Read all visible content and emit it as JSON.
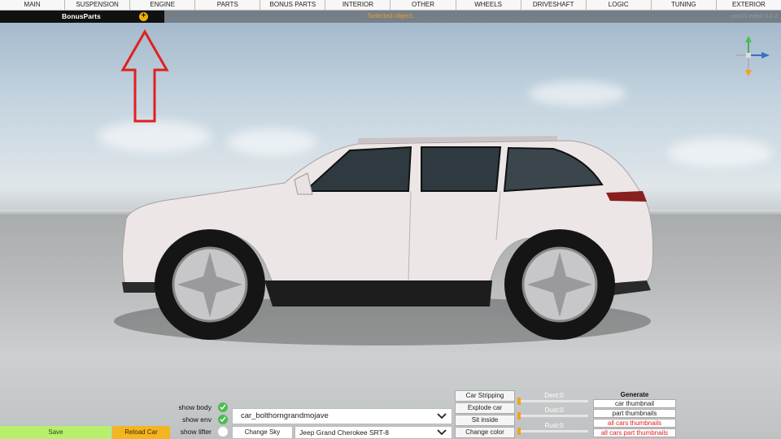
{
  "top_menu": {
    "tabs": [
      "MAIN",
      "SUSPENSION",
      "ENGINE",
      "PARTS",
      "BONUS PARTS",
      "INTERIOR",
      "OTHER",
      "WHEELS",
      "DRIVESHAFT",
      "LOGIC",
      "TUNING",
      "EXTERIOR"
    ]
  },
  "sub_bar": {
    "section_label": "BonusParts",
    "add_icon": "plus-circle-icon",
    "selected_object_label": "Selected object:",
    "version": "cms21 editor 1.0.2"
  },
  "colors": {
    "accent_orange": "#f3a21d",
    "save_green": "#b7ef6e",
    "reload_orange": "#f3b522",
    "check_green": "#4bbd52",
    "annotation_red": "#e02020"
  },
  "bottom": {
    "save_label": "Save",
    "reload_label": "Reload Car",
    "show_body_label": "show body",
    "show_env_label": "show env",
    "show_lifter_label": "show lifter",
    "car_id": "car_bolthorngrandmojave",
    "change_sky_label": "Change Sky",
    "model_name": "Jeep Grand Cherokee SRT-8",
    "actions": [
      "Car Stripping",
      "Explode car",
      "Sit inside",
      "Change color"
    ],
    "sliders": {
      "dent_label": "Dent:0",
      "dust_label": "Dust:0",
      "rust_label": "Rust:0"
    },
    "generate": {
      "title": "Generate",
      "buttons": [
        "car thumbnail",
        "part thumbnails",
        "all cars thumbnails",
        "all cars part thumbnails"
      ]
    }
  }
}
